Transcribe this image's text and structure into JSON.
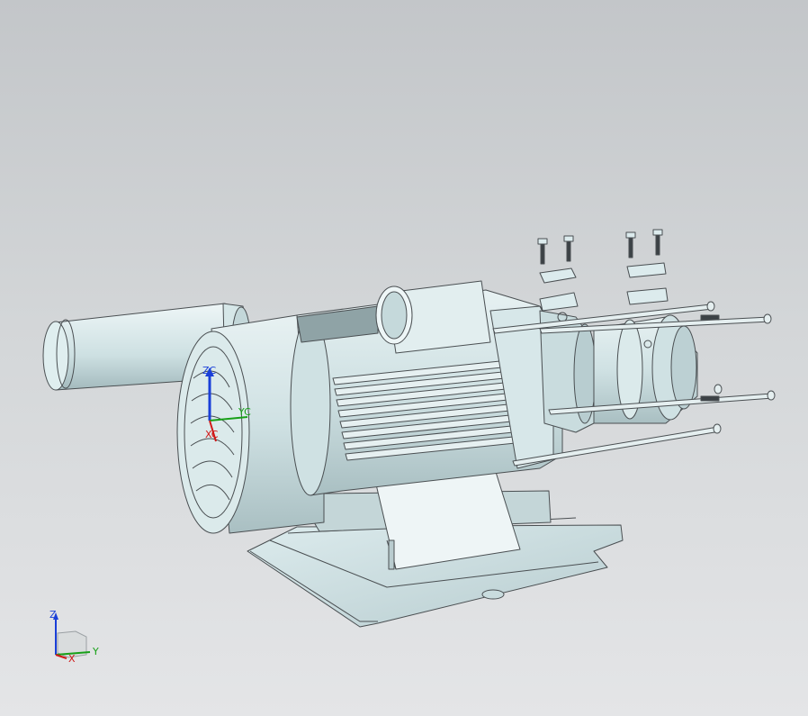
{
  "viewport": {
    "background_top": "#c3c6c9",
    "background_bottom": "#e4e5e7",
    "model_color": "#d2e4e6",
    "edge_color": "#4a4f52"
  },
  "csys": {
    "x_label": "XC",
    "y_label": "YC",
    "z_label": "ZC"
  },
  "triad": {
    "x_label": "X",
    "y_label": "Y",
    "z_label": "Z",
    "x_color": "#d01818",
    "y_color": "#18a018",
    "z_color": "#1a3fd8"
  }
}
